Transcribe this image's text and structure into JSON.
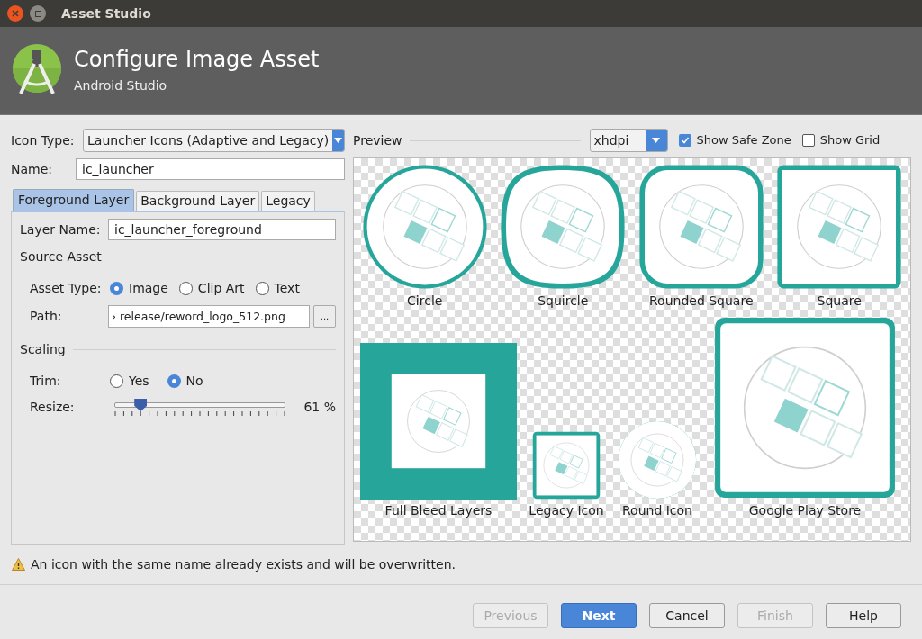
{
  "window": {
    "title": "Asset Studio"
  },
  "header": {
    "title": "Configure Image Asset",
    "subtitle": "Android Studio"
  },
  "icon_type": {
    "label": "Icon Type:",
    "value": "Launcher Icons (Adaptive and Legacy)"
  },
  "name": {
    "label": "Name:",
    "value": "ic_launcher"
  },
  "tabs": [
    {
      "label": "Foreground Layer",
      "selected": true
    },
    {
      "label": "Background Layer",
      "selected": false
    },
    {
      "label": "Legacy",
      "selected": false
    }
  ],
  "layer_name": {
    "label": "Layer Name:",
    "value": "ic_launcher_foreground"
  },
  "source_asset": {
    "heading": "Source Asset",
    "asset_type": {
      "label": "Asset Type:",
      "options": [
        {
          "label": "Image",
          "selected": true
        },
        {
          "label": "Clip Art",
          "selected": false
        },
        {
          "label": "Text",
          "selected": false
        }
      ]
    },
    "path": {
      "label": "Path:",
      "value": "› release/reword_logo_512.png",
      "browse": "..."
    }
  },
  "scaling": {
    "heading": "Scaling",
    "trim": {
      "label": "Trim:",
      "options": [
        {
          "label": "Yes",
          "selected": false
        },
        {
          "label": "No",
          "selected": true
        }
      ]
    },
    "resize": {
      "label": "Resize:",
      "level": 0.15,
      "reading": "61 %"
    }
  },
  "preview": {
    "label": "Preview",
    "density": "xhdpi",
    "show_safe_zone": {
      "label": "Show Safe Zone",
      "checked": true
    },
    "show_grid": {
      "label": "Show Grid",
      "checked": false
    },
    "icons": [
      {
        "label": "Circle",
        "kind": "circle"
      },
      {
        "label": "Squircle",
        "kind": "squircle"
      },
      {
        "label": "Rounded Square",
        "kind": "rounded"
      },
      {
        "label": "Square",
        "kind": "square"
      },
      {
        "label": "Full Bleed Layers",
        "kind": "fullbleed"
      },
      {
        "label": "Legacy Icon",
        "kind": "legacy"
      },
      {
        "label": "Round Icon",
        "kind": "round"
      },
      {
        "label": "Google Play Store",
        "kind": "play"
      }
    ]
  },
  "warning": "An icon with the same name already exists and will be overwritten.",
  "buttons": [
    {
      "label": "Previous",
      "disabled": true,
      "primary": false
    },
    {
      "label": "Next",
      "disabled": false,
      "primary": true
    },
    {
      "label": "Cancel",
      "disabled": false,
      "primary": false
    },
    {
      "label": "Finish",
      "disabled": true,
      "primary": false
    },
    {
      "label": "Help",
      "disabled": false,
      "primary": false
    }
  ]
}
